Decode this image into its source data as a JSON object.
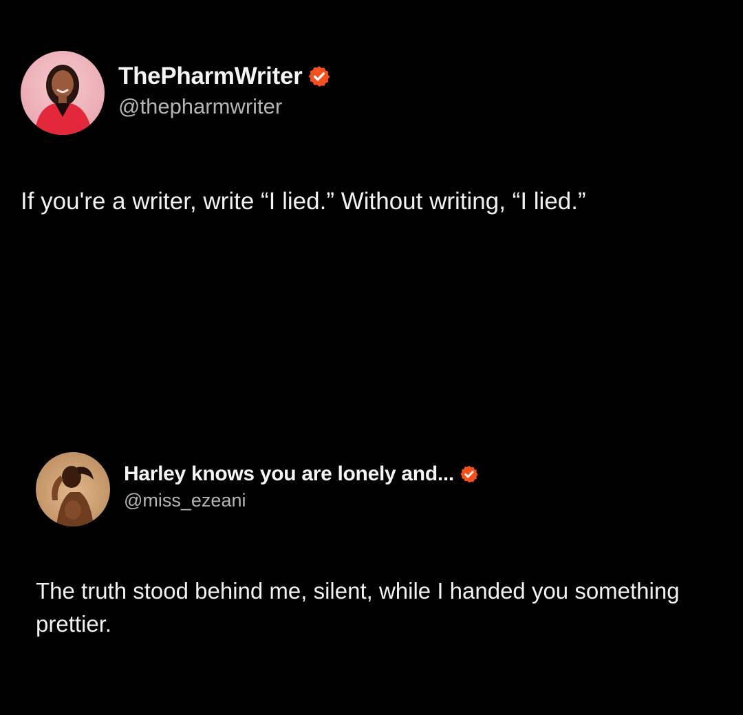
{
  "colors": {
    "background": "#000000",
    "text": "#f2f2f2",
    "handle": "#b5b5b5",
    "verified_badge": "#f4511e"
  },
  "posts": [
    {
      "author": {
        "display_name": "ThePharmWriter",
        "handle": "@thepharmwriter",
        "verified": true,
        "badge_icon": "verified-badge-icon",
        "avatar_icon": "avatar-photo"
      },
      "text": "If you're a writer, write “I lied.” Without writing, “I lied.”"
    },
    {
      "author": {
        "display_name": "Harley knows you are lonely and...",
        "handle": "@miss_ezeani",
        "verified": true,
        "badge_icon": "verified-badge-icon",
        "avatar_icon": "avatar-photo"
      },
      "text": "The truth stood behind me, silent, while I handed you something prettier."
    }
  ]
}
